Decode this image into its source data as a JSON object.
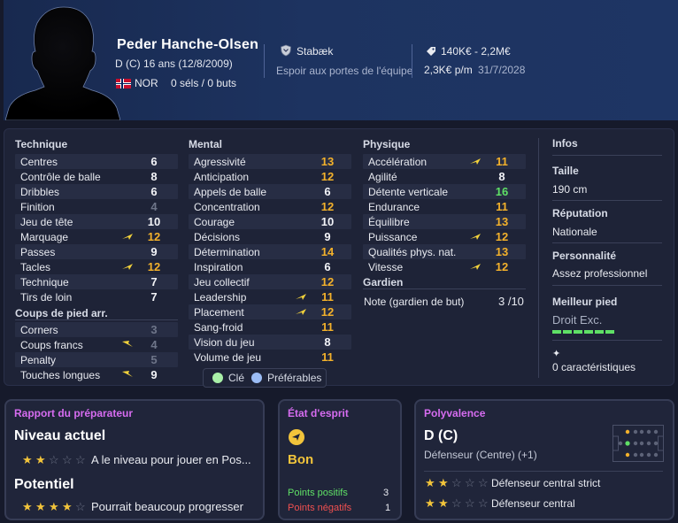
{
  "player": {
    "name": "Peder Hanche-Olsen",
    "position": "D (C)",
    "age": "16 ans (12/8/2009)",
    "nationality": "NOR",
    "caps": "0 séls / 0 buts",
    "club": "Stabæk",
    "club_role": "Espoir aux portes de l'équipe",
    "value": "140K€ - 2,2M€",
    "wage": "2,3K€ p/m",
    "contract_end": "31/7/2028"
  },
  "colors": {
    "accent_yellow": "#f3b12b",
    "accent_green": "#5fe066",
    "section_title": "#d66cf0",
    "header_bg": "#1d3360"
  },
  "technique": {
    "title": "Technique",
    "items": [
      {
        "label": "Centres",
        "value": "6"
      },
      {
        "label": "Contrôle de balle",
        "value": "8"
      },
      {
        "label": "Dribbles",
        "value": "6"
      },
      {
        "label": "Finition",
        "value": "4"
      },
      {
        "label": "Jeu de tête",
        "value": "10"
      },
      {
        "label": "Marquage",
        "value": "12"
      },
      {
        "label": "Passes",
        "value": "9"
      },
      {
        "label": "Tacles",
        "value": "12"
      },
      {
        "label": "Technique",
        "value": "7"
      },
      {
        "label": "Tirs de loin",
        "value": "7"
      }
    ]
  },
  "set_pieces": {
    "title": "Coups de pied arr.",
    "items": [
      {
        "label": "Corners",
        "value": "3"
      },
      {
        "label": "Coups francs",
        "value": "4"
      },
      {
        "label": "Penalty",
        "value": "5"
      },
      {
        "label": "Touches longues",
        "value": "9"
      }
    ]
  },
  "mental": {
    "title": "Mental",
    "items": [
      {
        "label": "Agressivité",
        "value": "13"
      },
      {
        "label": "Anticipation",
        "value": "12"
      },
      {
        "label": "Appels de balle",
        "value": "6"
      },
      {
        "label": "Concentration",
        "value": "12"
      },
      {
        "label": "Courage",
        "value": "10"
      },
      {
        "label": "Décisions",
        "value": "9"
      },
      {
        "label": "Détermination",
        "value": "14"
      },
      {
        "label": "Inspiration",
        "value": "6"
      },
      {
        "label": "Jeu collectif",
        "value": "12"
      },
      {
        "label": "Leadership",
        "value": "11"
      },
      {
        "label": "Placement",
        "value": "12"
      },
      {
        "label": "Sang-froid",
        "value": "11"
      },
      {
        "label": "Vision du jeu",
        "value": "8"
      },
      {
        "label": "Volume de jeu",
        "value": "11"
      }
    ]
  },
  "physique": {
    "title": "Physique",
    "items": [
      {
        "label": "Accélération",
        "value": "11"
      },
      {
        "label": "Agilité",
        "value": "8"
      },
      {
        "label": "Détente verticale",
        "value": "16"
      },
      {
        "label": "Endurance",
        "value": "11"
      },
      {
        "label": "Équilibre",
        "value": "13"
      },
      {
        "label": "Puissance",
        "value": "12"
      },
      {
        "label": "Qualités phys. nat.",
        "value": "13"
      },
      {
        "label": "Vitesse",
        "value": "12"
      }
    ]
  },
  "goalkeeper": {
    "title": "Gardien",
    "label": "Note (gardien de but)",
    "value": "3 /10"
  },
  "infos": {
    "title": "Infos",
    "height_label": "Taille",
    "height": "190 cm",
    "reputation_label": "Réputation",
    "reputation": "Nationale",
    "personality_label": "Personnalité",
    "personality": "Assez professionnel",
    "foot_label": "Meilleur pied",
    "foot": "Droit Exc.",
    "foot_level": 1.0,
    "traits": "0 caractéristiques"
  },
  "legend": {
    "key": "Clé",
    "preferred": "Préférables"
  },
  "coach_report": {
    "title": "Rapport du préparateur",
    "current_label": "Niveau actuel",
    "current_stars": 2,
    "current_text": "A le niveau pour jouer en Pos...",
    "potential_label": "Potentiel",
    "potential_stars": 4,
    "potential_text": "Pourrait beaucoup progresser"
  },
  "mindset": {
    "title": "État d'esprit",
    "state": "Bon",
    "positives_label": "Points positifs",
    "positives": "3",
    "negatives_label": "Points négatifs",
    "negatives": "1"
  },
  "versatility": {
    "title": "Polyvalence",
    "position": "D (C)",
    "position_desc": "Défenseur (Centre) (+1)",
    "roles": [
      {
        "label": "Défenseur central strict",
        "stars": 2
      },
      {
        "label": "Défenseur central",
        "stars": 2
      }
    ]
  }
}
